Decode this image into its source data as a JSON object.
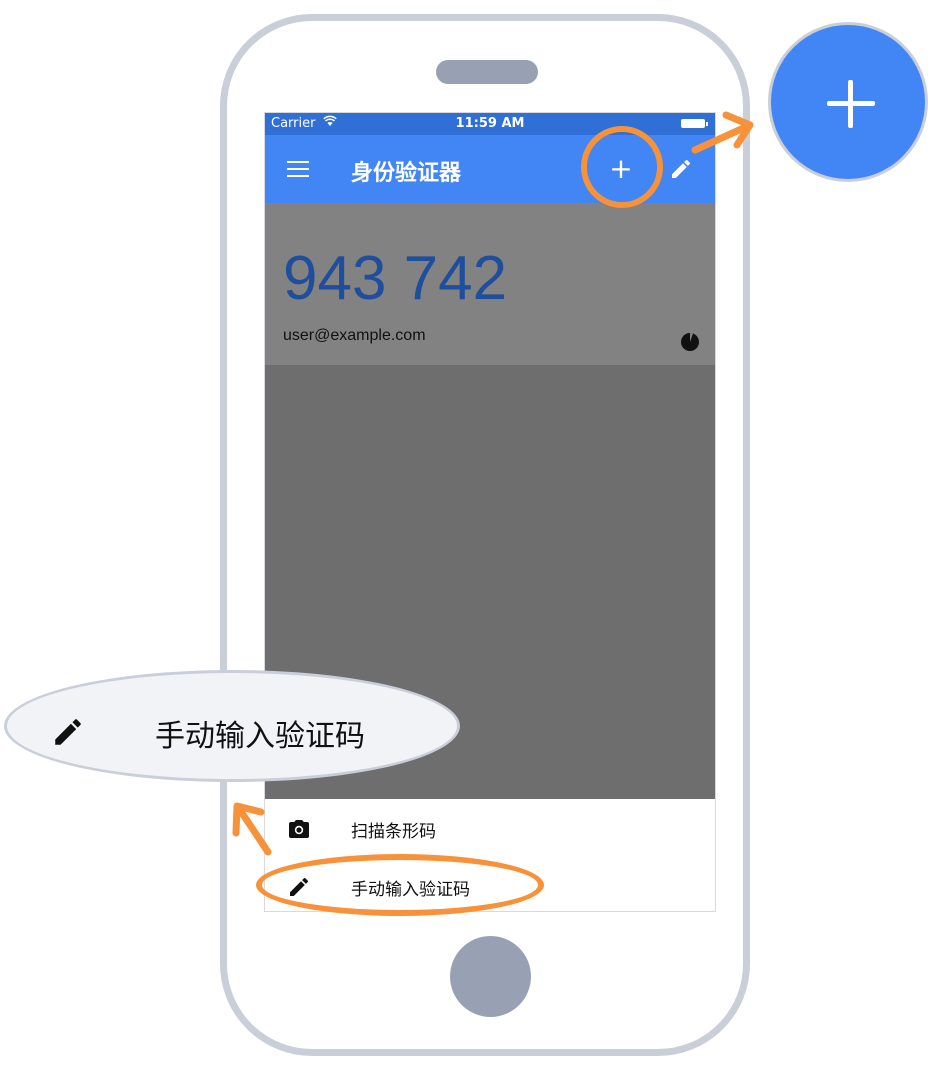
{
  "statusbar": {
    "carrier": "Carrier",
    "time": "11:59 AM"
  },
  "appbar": {
    "title": "身份验证器",
    "add_label": "+"
  },
  "card": {
    "code": "943 742",
    "account": "user@example.com"
  },
  "sheet": {
    "items": [
      {
        "label": "扫描条形码"
      },
      {
        "label": "手动输入验证码"
      }
    ]
  },
  "callout": {
    "manual_label": "手动输入验证码"
  },
  "colors": {
    "brand": "#4285f4",
    "highlight": "#f7923a",
    "frame": "#c9ced9"
  }
}
